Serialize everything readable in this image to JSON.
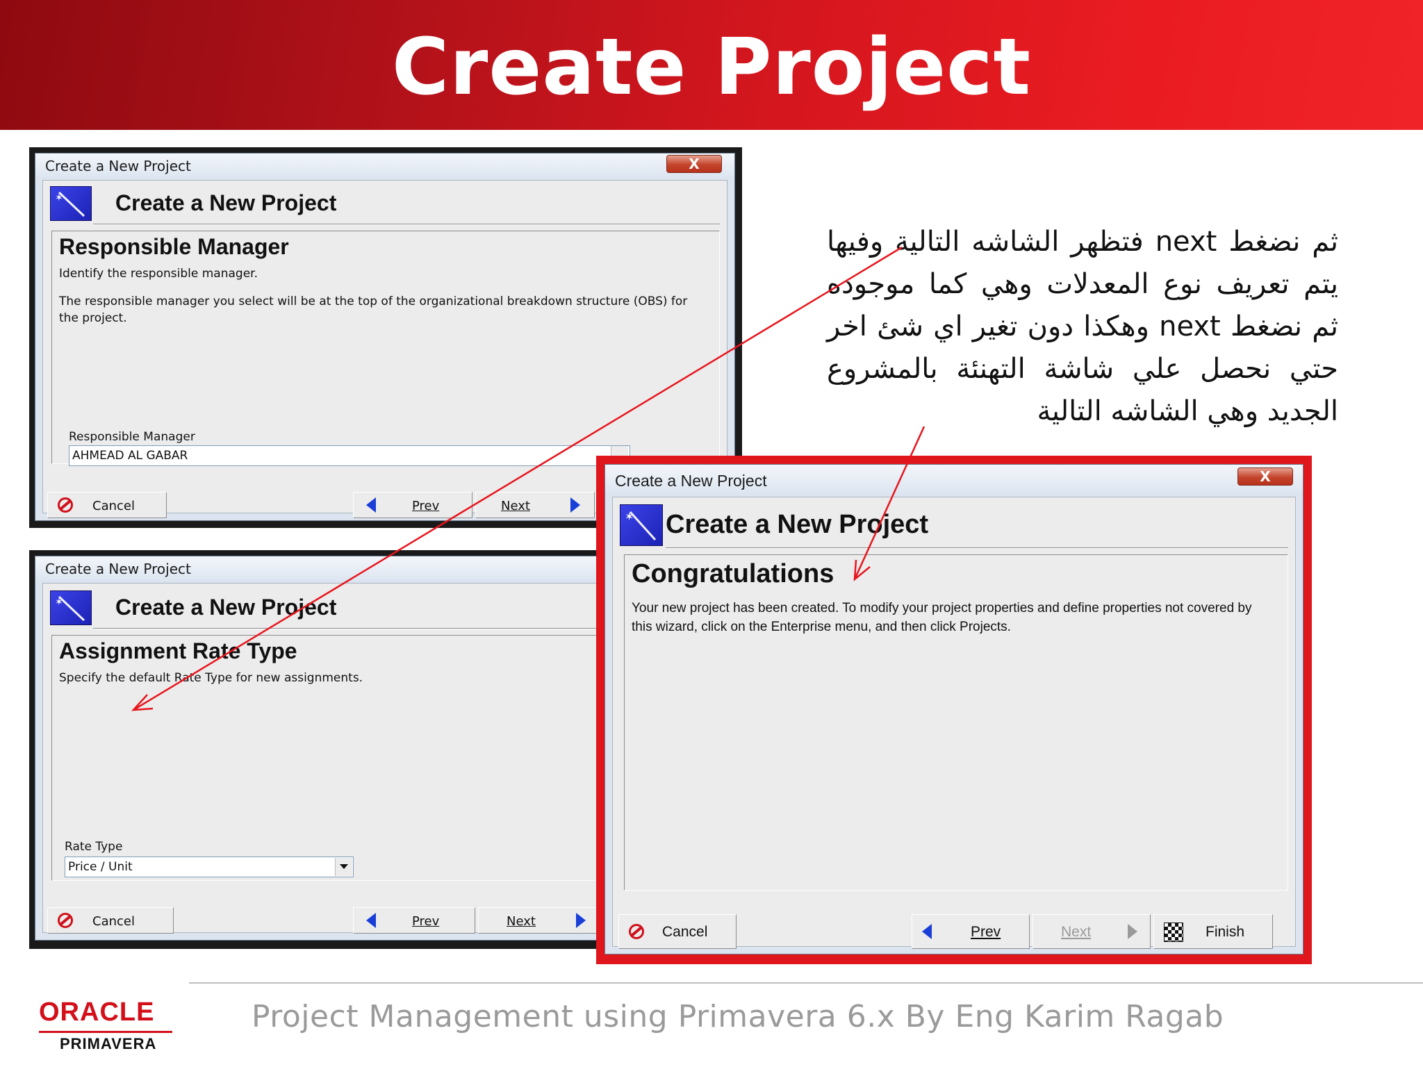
{
  "slide": {
    "title": "Create Project",
    "banner_color": "#d5161e",
    "accent_red": "#e0161d"
  },
  "dialog_responsible": {
    "window_title": "Create a New Project",
    "close_label": "X",
    "header_title": "Create a New Project",
    "panel_title": "Responsible Manager",
    "intro": "Identify the responsible manager.",
    "description": "The responsible manager you select will be at the top of the organizational breakdown structure (OBS) for the project.",
    "field_label": "Responsible Manager",
    "field_value": "AHMEAD AL GABAR",
    "browse_label": "...",
    "cancel_label": "Cancel",
    "prev_label": "Prev",
    "next_label": "Next"
  },
  "dialog_rate": {
    "window_title": "Create a New Project",
    "header_title": "Create a New Project",
    "panel_title": "Assignment Rate Type",
    "intro": "Specify the default Rate Type for new assignments.",
    "field_label": "Rate Type",
    "field_value": "Price / Unit",
    "cancel_label": "Cancel",
    "prev_label": "Prev",
    "next_label": "Next"
  },
  "dialog_congrats": {
    "window_title": "Create a New Project",
    "close_label": "X",
    "header_title": "Create a New Project",
    "panel_title": "Congratulations",
    "description": "Your new project has been created.  To modify your project properties and define properties not covered by this wizard, click on the Enterprise menu, and then click Projects.",
    "cancel_label": "Cancel",
    "prev_label": "Prev",
    "next_label": "Next",
    "finish_label": "Finish",
    "next_disabled": true
  },
  "arabic_note": "ثم نضغط  next فتظهر الشاشه التالية وفيها يتم تعريف نوع المعدلات وهي كما موجوده ثم نضغط  next وهكذا دون تغير اي شئ اخر حتي نحصل علي شاشة التهنئة بالمشروع الجديد وهي الشاشه التالية",
  "footer": {
    "logo_oracle": "ORACLE",
    "logo_primavera": "PRIMAVERA",
    "course_title": "Project Management using Primavera 6.x By Eng Karim Ragab"
  },
  "icons": [
    "wand-icon",
    "cancel-icon",
    "prev-arrow-icon",
    "next-arrow-icon",
    "finish-flag-icon",
    "dropdown-icon"
  ]
}
